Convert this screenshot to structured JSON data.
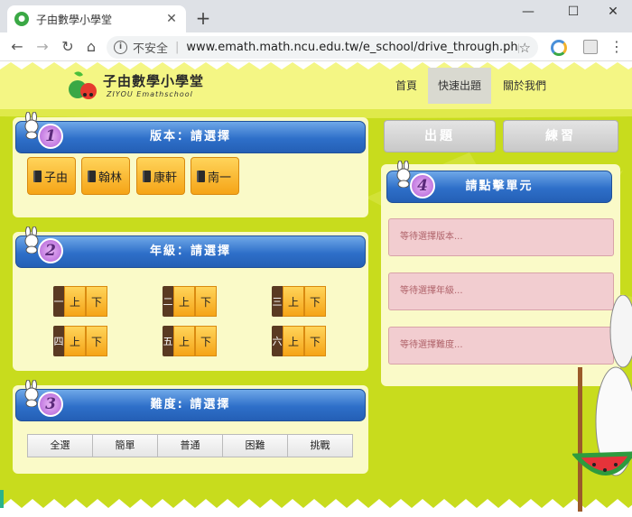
{
  "browser": {
    "tab_title": "子由數學小學堂",
    "new_tab_symbol": "+",
    "security_label": "不安全",
    "url": "www.emath.math.ncu.edu.tw/e_school/drive_through.php",
    "window_controls": [
      "minimize-icon",
      "maximize-icon",
      "close-icon"
    ]
  },
  "site": {
    "logo_title": "子由數學小學堂",
    "logo_subtitle": "ZIYOU Emathschool",
    "nav": [
      {
        "label": "首頁",
        "active": false
      },
      {
        "label": "快速出題",
        "active": true
      },
      {
        "label": "關於我們",
        "active": false
      }
    ]
  },
  "publisher_panel": {
    "number": "1",
    "title": "版本：請選擇",
    "options": [
      "子由",
      "翰林",
      "康軒",
      "南一"
    ]
  },
  "grade_panel": {
    "number": "2",
    "title": "年級：請選擇",
    "grades": [
      {
        "num": "一",
        "halves": [
          "上",
          "下"
        ]
      },
      {
        "num": "二",
        "halves": [
          "上",
          "下"
        ]
      },
      {
        "num": "三",
        "halves": [
          "上",
          "下"
        ]
      },
      {
        "num": "四",
        "halves": [
          "上",
          "下"
        ]
      },
      {
        "num": "五",
        "halves": [
          "上",
          "下"
        ]
      },
      {
        "num": "六",
        "halves": [
          "上",
          "下"
        ]
      }
    ]
  },
  "difficulty_panel": {
    "number": "3",
    "title": "難度: 請選擇",
    "options": [
      "全選",
      "簡單",
      "普通",
      "困難",
      "挑戰"
    ]
  },
  "actions": {
    "generate_label": "出題",
    "practice_label": "練習"
  },
  "unit_panel": {
    "number": "4",
    "title": "請點擊單元",
    "status": [
      "等待選擇版本...",
      "等待選擇年級...",
      "等待選擇難度..."
    ]
  },
  "colors": {
    "page_bg": "#c8dc1d",
    "panel_bg": "#fafac8",
    "header_blue": "#2e6fc9",
    "button_orange": "#f5a417",
    "status_pink": "#f2cdd0"
  }
}
